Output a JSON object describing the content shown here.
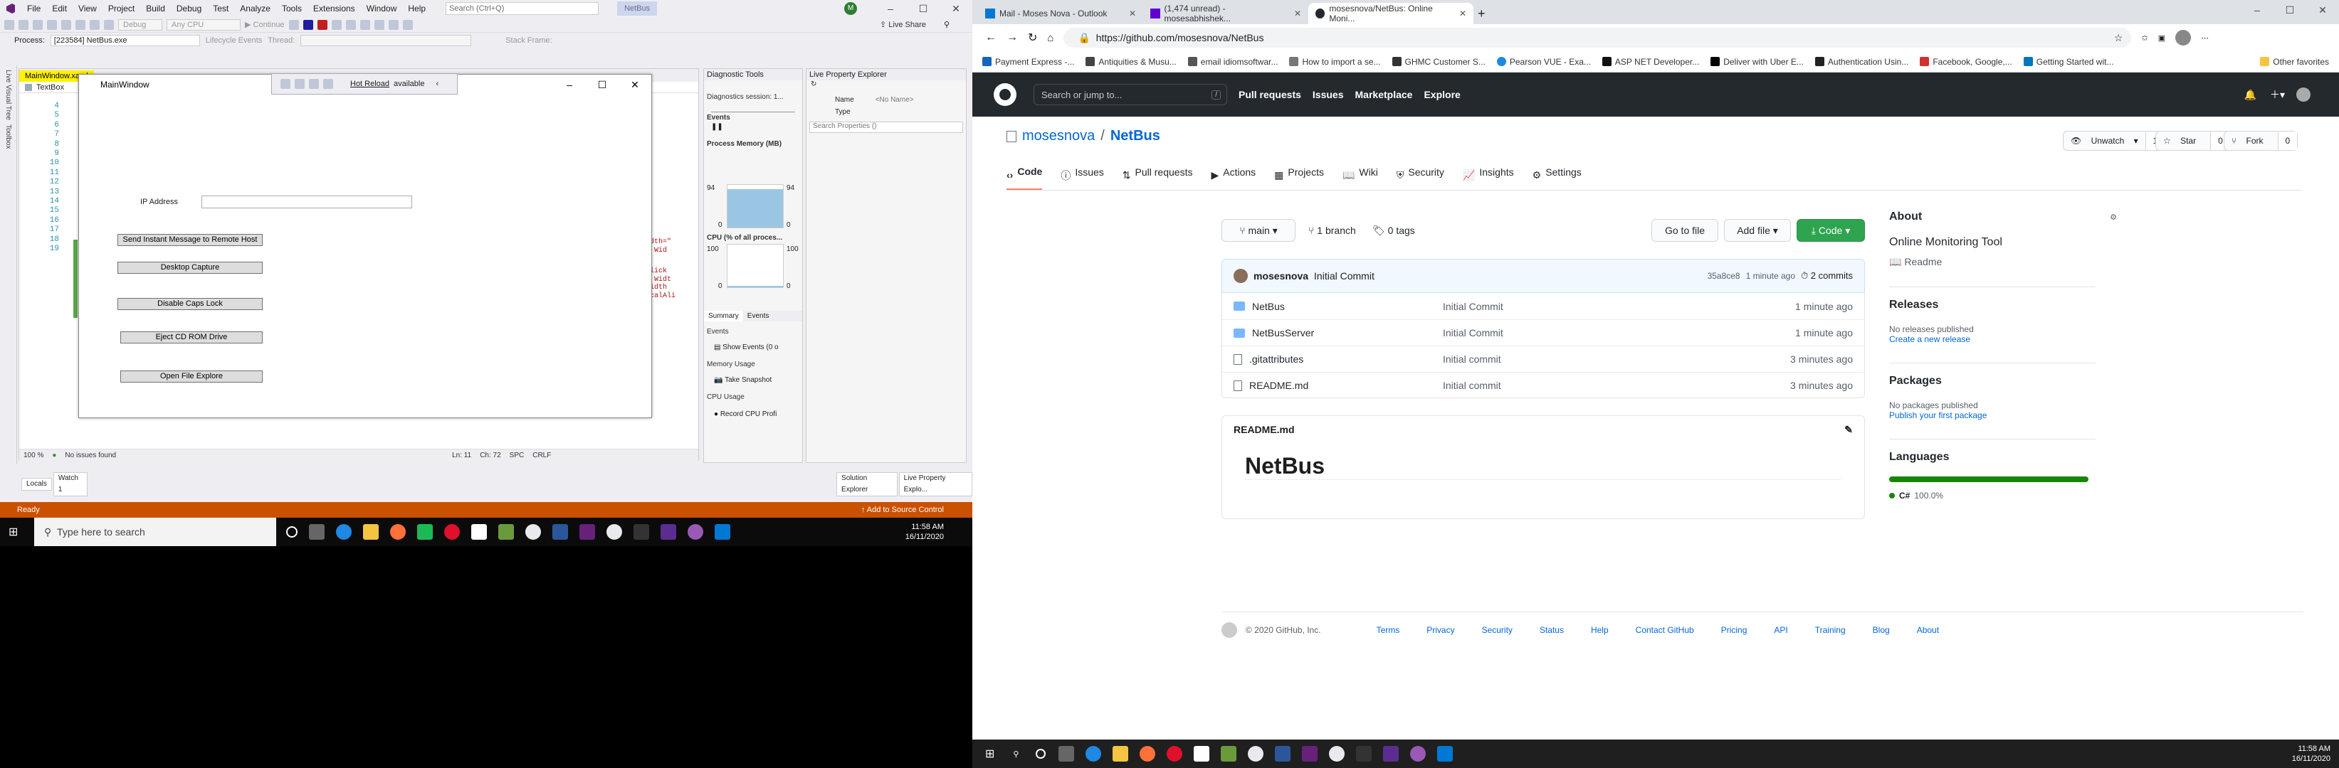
{
  "vs": {
    "menu": [
      "File",
      "Edit",
      "View",
      "Project",
      "Build",
      "Debug",
      "Test",
      "Analyze",
      "Tools",
      "Extensions",
      "Window",
      "Help"
    ],
    "search_placeholder": "Search (Ctrl+Q)",
    "project_name": "NetBus",
    "live_share": "Live Share",
    "toolbar": {
      "debug": "Debug",
      "cpu": "Any CPU",
      "continue": "Continue"
    },
    "process_label": "Process:",
    "process_value": "[223584] NetBus.exe",
    "lifecycle": "Lifecycle Events",
    "thread": "Thread:",
    "stack_frame": "Stack Frame:",
    "side_strip": [
      "Live Visual Tree",
      "Toolbox"
    ],
    "editor_tab": "MainWindow.xaml",
    "nav_item": "TextBox",
    "line_numbers": [
      "4",
      "5",
      "6",
      "7",
      "8",
      "9",
      "10",
      "11",
      "12",
      "13",
      "14",
      "15",
      "16",
      "17",
      "18",
      "19"
    ],
    "code_fragments": [
      "idth=\"",
      "\" Wid",
      "Click",
      "\" Widt",
      "Width",
      "icalAli"
    ],
    "zoom": "100 %",
    "issues": "No issues found",
    "ln": "Ln: 11",
    "ch": "Ch: 72",
    "spc": "SPC",
    "crlf": "CRLF",
    "bottom_tabs": [
      "Locals",
      "Watch 1"
    ],
    "right_bottom_tabs": [
      "Solution Explorer",
      "Live Property Explo..."
    ],
    "status_ready": "Ready",
    "status_source": "Add to Source Control"
  },
  "main_window": {
    "title": "MainWindow",
    "hot_reload": "Hot Reload",
    "hot_reload_suffix": "available",
    "ip_label": "IP Address",
    "buttons": [
      "Send Instant Message to Remote Host",
      "Desktop Capture",
      "Disable Caps Lock",
      "Eject CD ROM Drive",
      "Open File Explore"
    ]
  },
  "diag": {
    "title": "Diagnostic Tools",
    "session": "Diagnostics session: 1...",
    "events": "Events",
    "process_memory": "Process Memory (MB)",
    "mem_max": "94",
    "mem_min": "0",
    "cpu": "CPU (% of all proces...",
    "cpu_max": "100",
    "cpu_min": "0",
    "tabs": [
      "Summary",
      "Events"
    ],
    "events_h": "Events",
    "show_events": "Show Events (0 o",
    "memory_usage": "Memory Usage",
    "take_snapshot": "Take Snapshot",
    "cpu_usage": "CPU Usage",
    "record_cpu": "Record CPU Profi"
  },
  "lpe": {
    "title": "Live Property Explorer",
    "name_label": "Name",
    "name_value": "<No Name>",
    "type_label": "Type",
    "search_placeholder": "Search Properties ()"
  },
  "taskbar_left": {
    "search": "Type here to search",
    "time": "11:58 AM",
    "date": "16/11/2020"
  },
  "browser": {
    "tabs": [
      "Mail - Moses Nova - Outlook",
      "(1,474 unread) - mosesabhishek...",
      "mosesnova/NetBus: Online Moni..."
    ],
    "url": "https://github.com/mosesnova/NetBus",
    "bookmarks": [
      "Payment Express -...",
      "Antiquities & Musu...",
      "email idiomsoftwar...",
      "How to import a se...",
      "GHMC Customer S...",
      "Pearson VUE - Exa...",
      "ASP NET Developer...",
      "Deliver with Uber E...",
      "Authentication Usin...",
      "Facebook, Google,...",
      "Getting Started wit..."
    ],
    "other_bookmarks": "Other favorites"
  },
  "github": {
    "search": "Search or jump to...",
    "nav": [
      "Pull requests",
      "Issues",
      "Marketplace",
      "Explore"
    ],
    "owner": "mosesnova",
    "repo": "NetBus",
    "unwatch": "Unwatch",
    "unwatch_count": "1",
    "star": "Star",
    "star_count": "0",
    "fork": "Fork",
    "fork_count": "0",
    "tabs": [
      "Code",
      "Issues",
      "Pull requests",
      "Actions",
      "Projects",
      "Wiki",
      "Security",
      "Insights",
      "Settings"
    ],
    "branch": "main",
    "branches": "1 branch",
    "tags": "0 tags",
    "go_to_file": "Go to file",
    "add_file": "Add file",
    "code_btn": "Code",
    "commit_user": "mosesnova",
    "commit_msg": "Initial Commit",
    "commit_hash": "35a8ce8",
    "commit_time": "1 minute ago",
    "commits": "2 commits",
    "files": [
      {
        "name": "NetBus",
        "msg": "Initial Commit",
        "time": "1 minute ago",
        "type": "folder"
      },
      {
        "name": "NetBusServer",
        "msg": "Initial Commit",
        "time": "1 minute ago",
        "type": "folder"
      },
      {
        "name": ".gitattributes",
        "msg": "Initial commit",
        "time": "3 minutes ago",
        "type": "file"
      },
      {
        "name": "README.md",
        "msg": "Initial commit",
        "time": "3 minutes ago",
        "type": "file"
      }
    ],
    "readme_file": "README.md",
    "readme_h1": "NetBus",
    "about": "About",
    "about_desc": "Online Monitoring Tool",
    "readme_link": "Readme",
    "releases": "Releases",
    "no_releases": "No releases published",
    "create_release": "Create a new release",
    "packages": "Packages",
    "no_packages": "No packages published",
    "publish_package": "Publish your first package",
    "languages": "Languages",
    "lang": "C#",
    "lang_pct": "100.0%",
    "lang_color": "#178600",
    "footer_copy": "© 2020 GitHub, Inc.",
    "footer_links": [
      "Terms",
      "Privacy",
      "Security",
      "Status",
      "Help",
      "Contact GitHub",
      "Pricing",
      "API",
      "Training",
      "Blog",
      "About"
    ]
  },
  "taskbar_right": {
    "time": "11:58 AM",
    "date": "16/11/2020"
  }
}
